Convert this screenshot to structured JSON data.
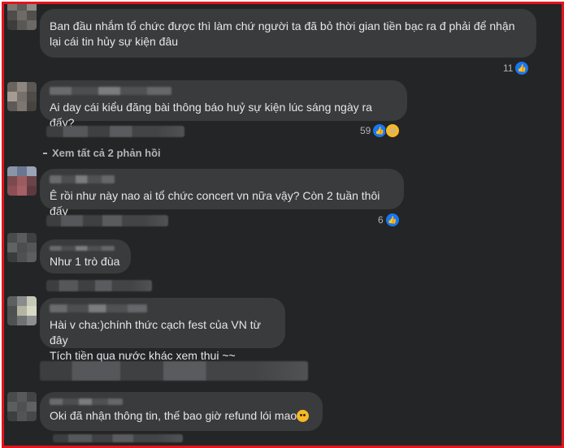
{
  "comments": [
    {
      "text": "Ban đầu nhắm tổ chức được thì làm chứ người ta đã bỏ thời gian tiền bạc ra đ phải để nhận lại cái tin hủy sự kiện đâu",
      "reaction_count": "11"
    },
    {
      "text": "Ai day cái kiểu đăng bài thông báo huỷ sự kiện lúc sáng ngày ra đấy?",
      "reaction_count": "59"
    },
    {
      "text": "Ê rồi như này nao ai tổ chức concert vn nữa vậy? Còn 2 tuần thôi đấy",
      "reaction_count": "6"
    },
    {
      "text": "Như 1 trò đùa"
    },
    {
      "text": "Hài v cha:)chính thức cạch fest của VN từ đây\nTích tiền qua nước khác xem thui ~~"
    },
    {
      "text": "Oki đã nhận thông tin, thế bao giờ refund lói mao",
      "emoji": "face-with-rolling-eyes-icon"
    }
  ],
  "view_replies_label": "Xem tất cả 2 phản hồi",
  "colors": {
    "background": "#242526",
    "bubble": "#3a3b3c",
    "text": "#e4e6eb",
    "muted": "#b0b3b8",
    "like": "#1877f2",
    "frame_border": "#e3141c"
  },
  "icons": [
    "like-icon",
    "haha-icon",
    "reply-arrow-icon"
  ]
}
